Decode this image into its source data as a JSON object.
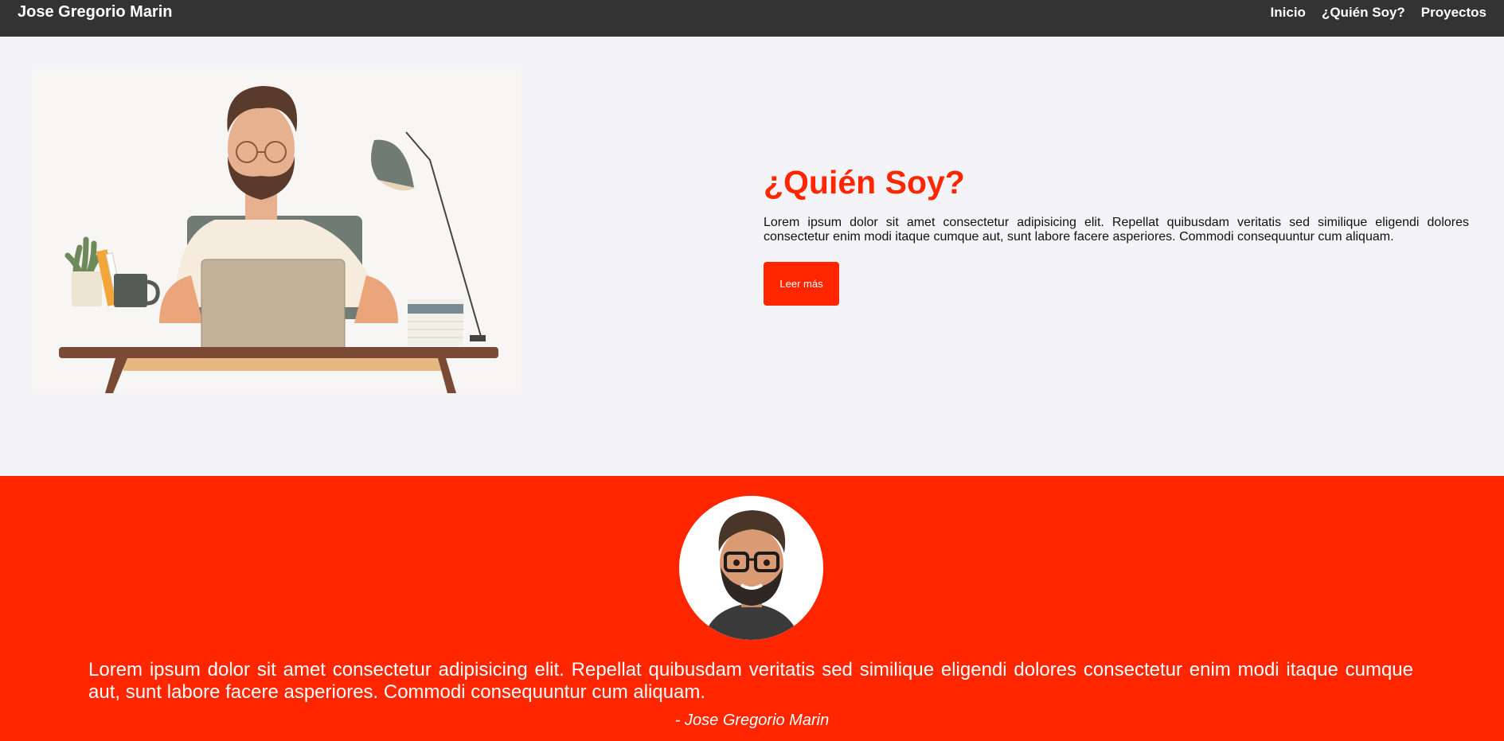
{
  "navbar": {
    "brand": "Jose Gregorio Marin",
    "links": [
      "Inicio",
      "¿Quién Soy?",
      "Proyectos"
    ]
  },
  "about": {
    "title": "¿Quién Soy?",
    "paragraph": "Lorem ipsum dolor sit amet consectetur adipisicing elit. Repellat quibusdam veritatis sed similique eligendi dolores consectetur enim modi itaque cumque aut, sunt labore facere asperiores. Commodi consequuntur cum aliquam.",
    "button_label": "Leer más"
  },
  "testimonial": {
    "quote": "Lorem ipsum dolor sit amet consectetur adipisicing elit. Repellat quibusdam veritatis sed similique eligendi dolores consectetur enim modi itaque cumque aut, sunt labore facere asperiores. Commodi consequuntur cum aliquam.",
    "author": "- Jose Gregorio Marin"
  },
  "colors": {
    "navbar_bg": "#333333",
    "accent": "#ff2600",
    "section_bg": "#f4f4f8"
  }
}
